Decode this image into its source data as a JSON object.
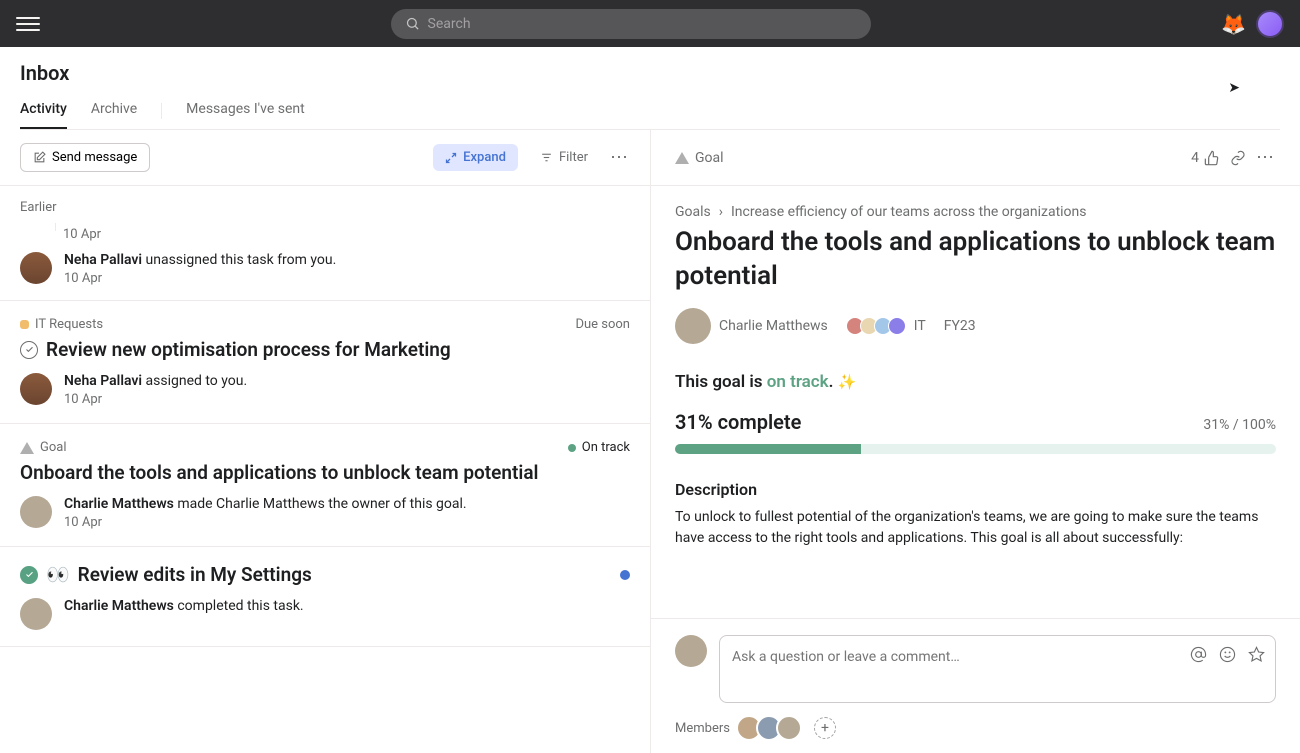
{
  "search": {
    "placeholder": "Search"
  },
  "page": {
    "title": "Inbox"
  },
  "tabs": {
    "activity": "Activity",
    "archive": "Archive",
    "sent": "Messages I've sent"
  },
  "toolbar": {
    "send": "Send message",
    "expand": "Expand",
    "filter": "Filter"
  },
  "section_earlier": "Earlier",
  "feed": {
    "ts_prev": "10 Apr",
    "item0": {
      "actor": "Neha Pallavi",
      "action": " unassigned this task from you.",
      "date": "10 Apr"
    },
    "item1": {
      "project": "IT Requests",
      "due": "Due soon",
      "title": "Review new optimisation process for Marketing",
      "actor": "Neha Pallavi",
      "action": " assigned to you.",
      "date": "10 Apr"
    },
    "item2": {
      "type": "Goal",
      "status": "On track",
      "title": "Onboard the tools and applications to unblock team potential",
      "actor": "Charlie Matthews",
      "action": " made Charlie Matthews the owner of this goal.",
      "date": "10 Apr"
    },
    "item3": {
      "emoji": "👀",
      "title": "Review edits in My Settings",
      "actor": "Charlie Matthews",
      "action": " completed this task."
    }
  },
  "goal": {
    "header_type": "Goal",
    "likes": "4",
    "crumb1": "Goals",
    "crumb2": "Increase efficiency of our teams across the organizations",
    "title": "Onboard the tools and applications to unblock team potential",
    "owner": "Charlie Matthews",
    "team": "IT",
    "period": "FY23",
    "status_prefix": "This goal is ",
    "status_value": "on track",
    "status_suffix": ".",
    "progress_label": "31% complete",
    "progress_ratio": "31% / 100%",
    "progress_pct": 31,
    "desc_heading": "Description",
    "desc": "To unlock to fullest potential of the organization's teams, we are going to make sure the teams have access to the right tools and applications. This goal is all about successfully:",
    "comment_placeholder": "Ask a question or leave a comment…",
    "members_label": "Members"
  }
}
